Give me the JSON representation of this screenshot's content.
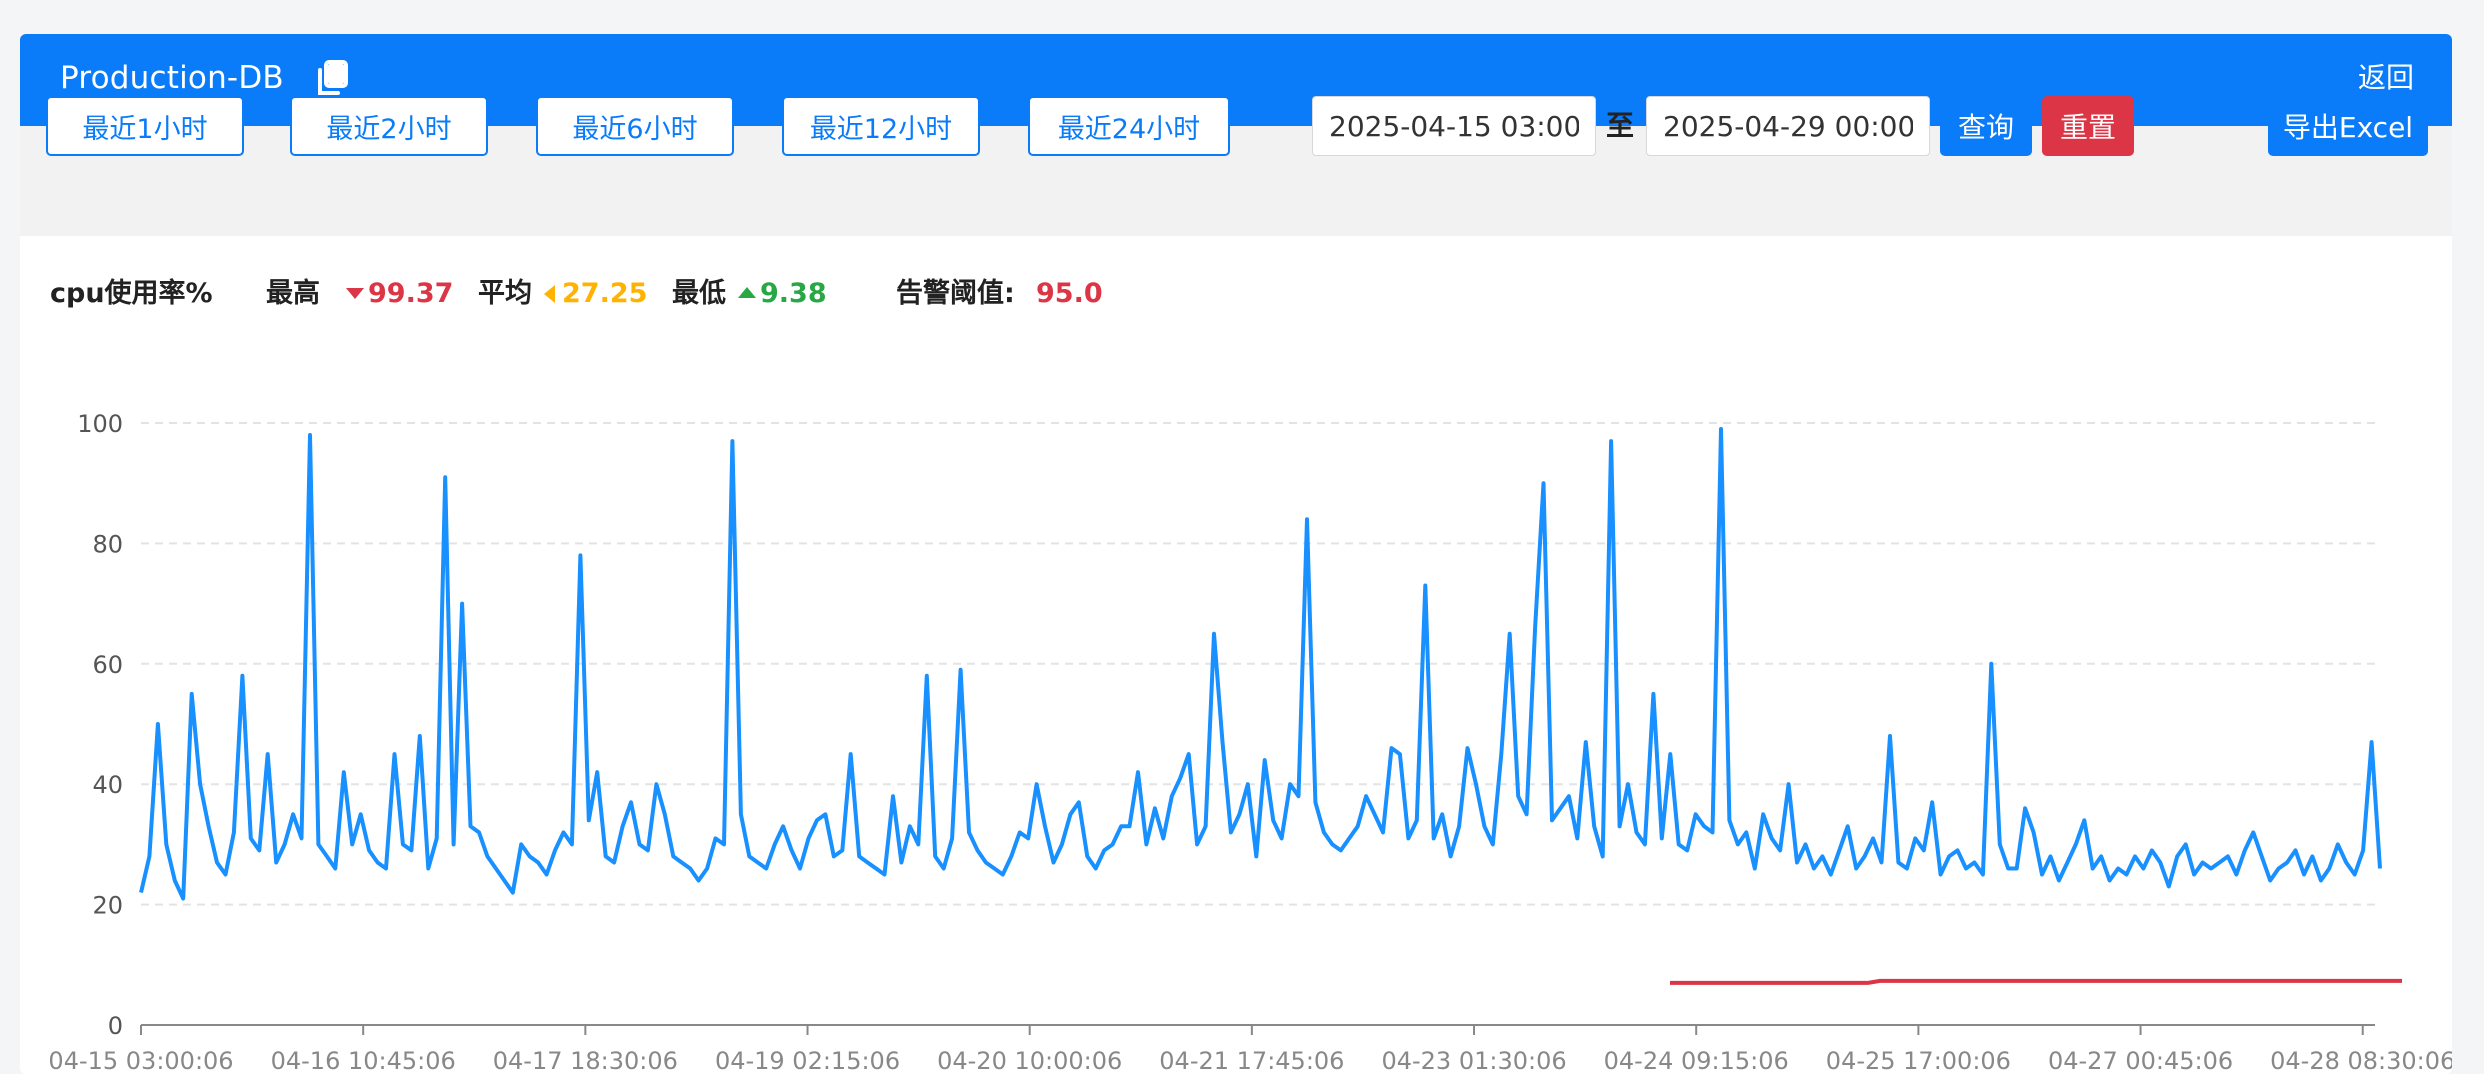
{
  "header": {
    "title": "Production-DB",
    "back_label": "返回"
  },
  "toolbar": {
    "range_buttons": [
      "最近1小时",
      "最近2小时",
      "最近6小时",
      "最近12小时",
      "最近24小时"
    ],
    "start_date": "2025-04-15 03:00",
    "to_label": "至",
    "end_date": "2025-04-29 00:00",
    "query_label": "查询",
    "reset_label": "重置",
    "export_label": "导出Excel"
  },
  "colors": {
    "brand": "#0a7cfa",
    "series": "#1890ff",
    "max": "#dc3545",
    "avg": "#ffb300",
    "min": "#28a745",
    "threshold": "#dc3545"
  },
  "stats": {
    "metric_label": "cpu使用率%",
    "max_label": "最高",
    "max_value": "99.37",
    "avg_label": "平均",
    "avg_value": "27.25",
    "min_label": "最低",
    "min_value": "9.38",
    "threshold_label": "告警阈值:",
    "threshold_value": "95.0"
  },
  "chart_data": {
    "type": "line",
    "x_ticks": [
      "04-15 03:00:06",
      "04-16 10:45:06",
      "04-17 18:30:06",
      "04-19 02:15:06",
      "04-20 10:00:06",
      "04-21 17:45:06",
      "04-23 01:30:06",
      "04-24 09:15:06",
      "04-25 17:00:06",
      "04-27 00:45:06",
      "04-28 08:30:06"
    ],
    "y_ticks": [
      "0",
      "20",
      "40",
      "60",
      "80",
      "100"
    ],
    "ylim": [
      0,
      100
    ],
    "grid": true,
    "series": [
      {
        "values": [
          22,
          28,
          50,
          30,
          24,
          21,
          55,
          40,
          33,
          27,
          25,
          32,
          58,
          31,
          29,
          45,
          27,
          30,
          35,
          31,
          98,
          30,
          28,
          26,
          42,
          30,
          35,
          29,
          27,
          26,
          45,
          30,
          29,
          48,
          26,
          31,
          91,
          30,
          70,
          33,
          32,
          28,
          26,
          24,
          22,
          30,
          28,
          27,
          25,
          29,
          32,
          30,
          78,
          34,
          42,
          28,
          27,
          33,
          37,
          30,
          29,
          40,
          35,
          28,
          27,
          26,
          24,
          26,
          31,
          30,
          97,
          35,
          28,
          27,
          26,
          30,
          33,
          29,
          26,
          31,
          34,
          35,
          28,
          29,
          45,
          28,
          27,
          26,
          25,
          38,
          27,
          33,
          30,
          58,
          28,
          26,
          31,
          59,
          32,
          29,
          27,
          26,
          25,
          28,
          32,
          31,
          40,
          33,
          27,
          30,
          35,
          37,
          28,
          26,
          29,
          30,
          33,
          33,
          42,
          30,
          36,
          31,
          38,
          41,
          45,
          30,
          33,
          65,
          47,
          32,
          35,
          40,
          28,
          44,
          34,
          31,
          40,
          38,
          84,
          37,
          32,
          30,
          29,
          31,
          33,
          38,
          35,
          32,
          46,
          45,
          31,
          34,
          73,
          31,
          35,
          28,
          33,
          46,
          40,
          33,
          30,
          45,
          65,
          38,
          35,
          66,
          90,
          34,
          36,
          38,
          31,
          47,
          33,
          28,
          97,
          33,
          40,
          32,
          30,
          55,
          31,
          45,
          30,
          29,
          35,
          33,
          32,
          99,
          34,
          30,
          32,
          26,
          35,
          31,
          29,
          40,
          27,
          30,
          26,
          28,
          25,
          29,
          33,
          26,
          28,
          31,
          27,
          48,
          27,
          26,
          31,
          29,
          37,
          25,
          28,
          29,
          26,
          27,
          25,
          60,
          30,
          26,
          26,
          36,
          32,
          25,
          28,
          24,
          27,
          30,
          34,
          26,
          28,
          24,
          26,
          25,
          28,
          26,
          29,
          27,
          23,
          28,
          30,
          25,
          27,
          26,
          27,
          28,
          25,
          29,
          32,
          28,
          24,
          26,
          27,
          29,
          25,
          28,
          24,
          26,
          30,
          27,
          25,
          29,
          47,
          26
        ],
        "threshold_segment": {
          "x_start": "04-24 04:00",
          "x_end": "04-28 10:00",
          "value": 7
        }
      }
    ]
  }
}
